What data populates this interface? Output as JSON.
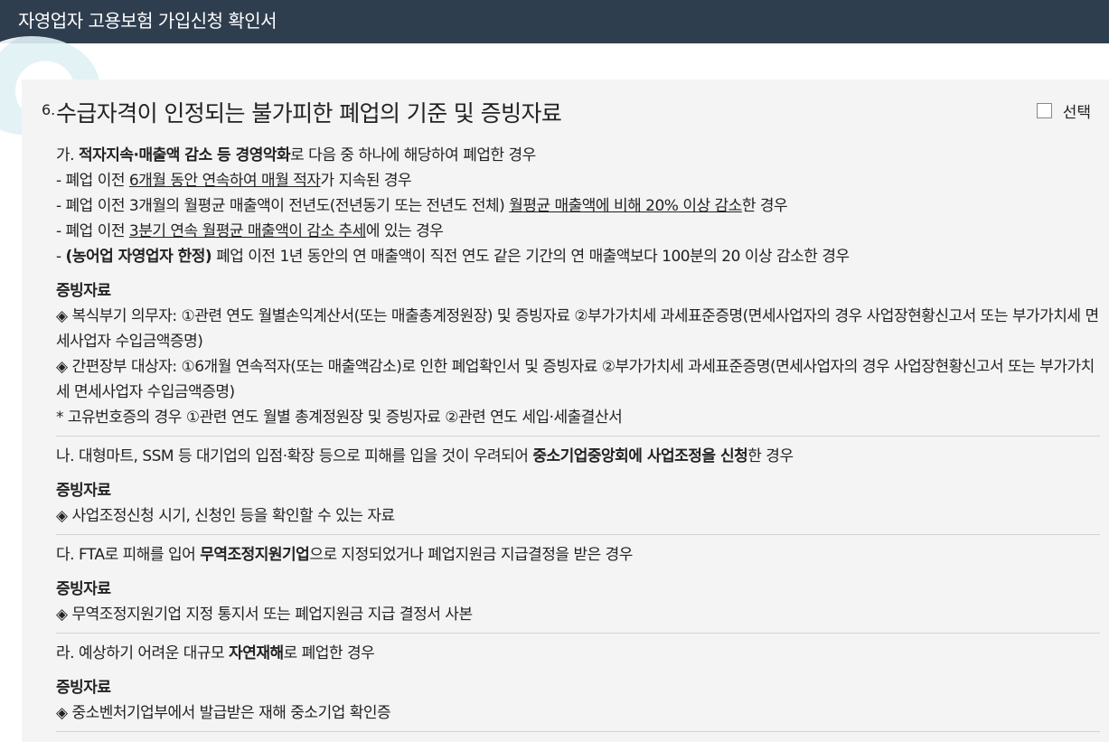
{
  "window": {
    "title": "자영업자 고용보험 가입신청 확인서"
  },
  "section": {
    "number": "6.",
    "title": "수급자격이 인정되는 불가피한 폐업의 기준 및 증빙자료",
    "checkbox_label": "선택"
  },
  "a": {
    "intro_prefix": "가. ",
    "intro_bold": "적자지속·매출액 감소 등 경영악화",
    "intro_suffix": "로 다음 중 하나에 해당하여 폐업한 경우",
    "b1_prefix": "- 폐업 이전 ",
    "b1_u": "6개월 동안 연속하여 매월 적자",
    "b1_suffix": "가 지속된 경우",
    "b2_prefix": "- 폐업 이전 3개월의 월평균 매출액이 전년도(전년동기 또는 전년도 전체) ",
    "b2_u": "월평균 매출액에 비해 20% 이상 감소",
    "b2_suffix": "한 경우",
    "b3_prefix": "- 폐업 이전 ",
    "b3_u": "3분기 연속 월평균 매출액이 감소 추세",
    "b3_suffix": "에 있는 경우",
    "b4_prefix": "- ",
    "b4_bold": "(농어업 자영업자 한정)",
    "b4_suffix": " 폐업 이전 1년 동안의 연 매출액이 직전 연도 같은 기간의 연 매출액보다 100분의 20 이상 감소한 경우",
    "evidence_heading": "증빙자료",
    "e1": "◈ 복식부기 의무자: ①관련 연도 월별손익계산서(또는 매출총계정원장) 및 증빙자료 ②부가가치세 과세표준증명(면세사업자의 경우 사업장현황신고서 또는 부가가치세 면세사업자 수입금액증명)",
    "e2": "◈ 간편장부 대상자: ①6개월 연속적자(또는 매출액감소)로 인한 폐업확인서 및 증빙자료 ②부가가치세 과세표준증명(면세사업자의 경우 사업장현황신고서 또는 부가가치세 면세사업자 수입금액증명)",
    "e3": "* 고유번호증의 경우 ①관련 연도 월별 총계정원장 및 증빙자료 ②관련 연도 세입·세출결산서"
  },
  "b": {
    "intro_prefix": "나. 대형마트, SSM 등 대기업의 입점·확장 등으로 피해를 입을 것이 우려되어 ",
    "intro_bold": "중소기업중앙회에 사업조정을 신청",
    "intro_suffix": "한 경우",
    "evidence_heading": "증빙자료",
    "e1": " ◈ 사업조정신청 시기, 신청인 등을 확인할 수 있는 자료"
  },
  "c": {
    "intro_prefix": "다. FTA로 피해를 입어 ",
    "intro_bold": "무역조정지원기업",
    "intro_suffix": "으로 지정되었거나 폐업지원금 지급결정을 받은 경우",
    "evidence_heading": "증빙자료",
    "e1": " ◈ 무역조정지원기업 지정 통지서 또는 폐업지원금 지급 결정서 사본"
  },
  "d": {
    "intro_prefix": "라. 예상하기 어려운 대규모 ",
    "intro_bold": "자연재해",
    "intro_suffix": "로 폐업한 경우",
    "evidence_heading": "증빙자료",
    "e1": "◈ 중소벤처기업부에서 발급받은 재해 중소기업 확인증"
  }
}
